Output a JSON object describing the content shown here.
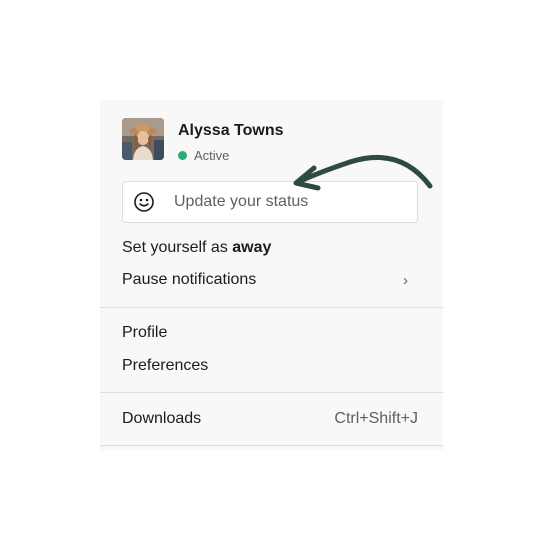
{
  "user": {
    "name": "Alyssa Towns",
    "presence": "Active",
    "presence_color": "#2bac76"
  },
  "status": {
    "placeholder": "Update your status",
    "icon": "smiley-icon"
  },
  "menu": {
    "away_prefix": "Set yourself as ",
    "away_bold": "away",
    "pause_label": "Pause notifications",
    "pause_chevron": "›",
    "profile_label": "Profile",
    "preferences_label": "Preferences",
    "downloads_label": "Downloads",
    "downloads_shortcut": "Ctrl+Shift+J"
  },
  "annotation": {
    "arrow_color": "#2f4a3f"
  }
}
